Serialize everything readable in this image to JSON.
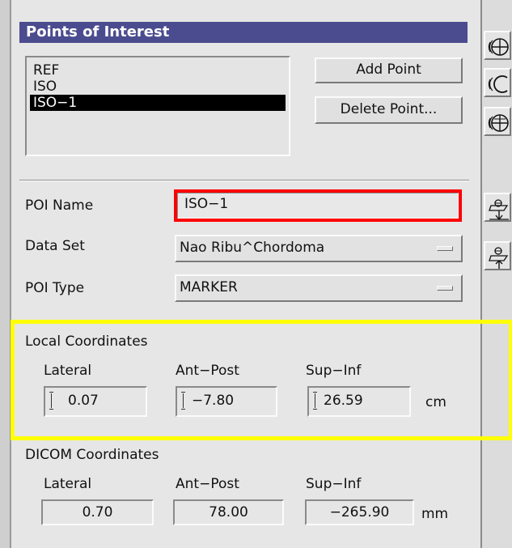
{
  "poi_panel": {
    "title": "Points of Interest",
    "points": [
      {
        "label": "REF",
        "selected": false
      },
      {
        "label": "ISO",
        "selected": false
      },
      {
        "label": "ISO−1",
        "selected": true
      }
    ],
    "add_point_label": "Add Point",
    "delete_point_label": "Delete Point..."
  },
  "poi_form": {
    "name_label": "POI Name",
    "name_value": "ISO−1",
    "dataset_label": "Data Set",
    "dataset_value": "Nao Ribu^Chordoma",
    "type_label": "POI Type",
    "type_value": "MARKER"
  },
  "local_coords": {
    "title": "Local Coordinates",
    "lateral_label": "Lateral",
    "antpost_label": "Ant−Post",
    "supinf_label": "Sup−Inf",
    "lateral_value": "0.07",
    "antpost_value": "−7.80",
    "supinf_value": "26.59",
    "unit": "cm"
  },
  "dicom_coords": {
    "title": "DICOM Coordinates",
    "lateral_label": "Lateral",
    "antpost_label": "Ant−Post",
    "supinf_label": "Sup−Inf",
    "lateral_value": "0.70",
    "antpost_value": "78.00",
    "supinf_value": "−265.90",
    "unit": "mm"
  },
  "toolbar": {
    "icons": [
      "crosshair-circle-icon",
      "half-circle-icon",
      "crosshair-circle-alt-icon",
      "plane-down-icon",
      "plane-up-icon"
    ]
  },
  "colors": {
    "title_bar": "#4b4b8f",
    "selection": "#000000",
    "error_outline": "#ff0000",
    "highlight": "#ffff00"
  }
}
